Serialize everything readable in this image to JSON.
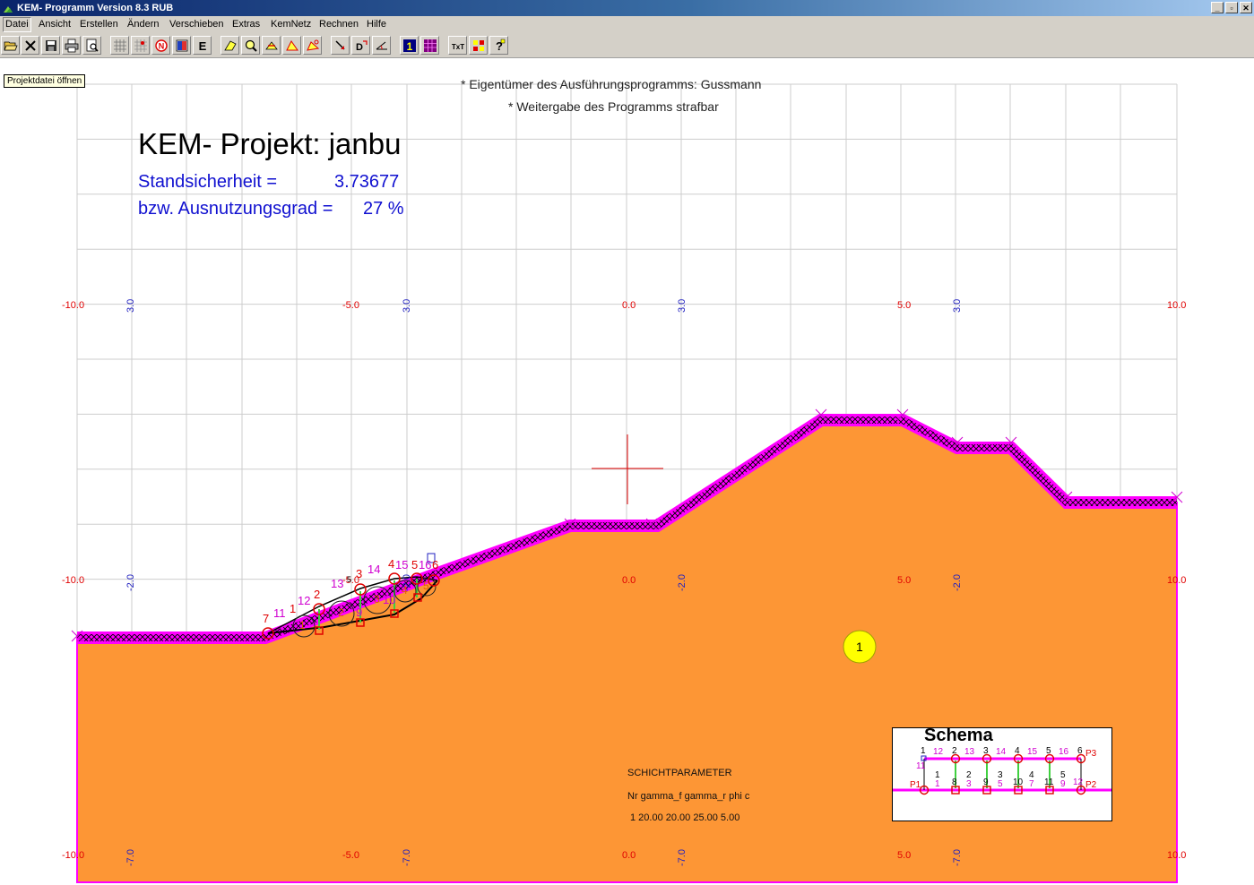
{
  "window": {
    "title": "KEM- Programm Version 8.3 RUB",
    "controls": [
      "_",
      "▫",
      "✕"
    ]
  },
  "menu": [
    "Datei",
    "Ansicht",
    "Erstellen",
    "Ändern",
    "Verschieben",
    "Extras",
    "KemNetz",
    "Rechnen",
    "Hilfe"
  ],
  "toolbar": {
    "buttons": [
      {
        "name": "open-icon",
        "tooltip": "Projektdatei öffnen"
      },
      {
        "name": "close-icon"
      },
      {
        "name": "save-icon"
      },
      {
        "name": "print-icon"
      },
      {
        "name": "print-preview-icon"
      },
      {
        "name": "grid-icon"
      },
      {
        "name": "grid-point-icon"
      },
      {
        "name": "north-icon"
      },
      {
        "name": "layer-icon"
      },
      {
        "name": "e-icon"
      },
      {
        "name": "edit-polygon-icon"
      },
      {
        "name": "zoom-icon"
      },
      {
        "name": "move-icon"
      },
      {
        "name": "triangle-icon"
      },
      {
        "name": "rotate-icon"
      },
      {
        "name": "arrow-down-icon"
      },
      {
        "name": "d-icon"
      },
      {
        "name": "angle-icon"
      },
      {
        "name": "one-icon"
      },
      {
        "name": "matrix-icon"
      },
      {
        "name": "text-icon"
      },
      {
        "name": "palette-icon"
      },
      {
        "name": "help-icon"
      }
    ]
  },
  "tooltip": "Projektdatei öffnen",
  "notices": [
    "* Eigentümer des Ausführungsprogramms: Gussmann",
    "* Weitergabe des Programms strafbar"
  ],
  "project": {
    "title": "KEM- Projekt: janbu",
    "safety_label": "Standsicherheit =",
    "safety_value": "3.73677",
    "utilization_label": "bzw. Ausnutzungsgrad =",
    "utilization_value": "27 %"
  },
  "axes": {
    "red_labels_top": [
      "-10.0",
      "-5.0",
      "0.0",
      "5.0",
      "10.0"
    ],
    "red_labels_mid": [
      "-10.0",
      "-5.0",
      "0.0",
      "5.0",
      "10.0"
    ],
    "red_labels_bottom": [
      "-10.0",
      "-5.0",
      "0.0",
      "5.0",
      "10.0"
    ],
    "blue_labels_top": [
      "3.0",
      "3.0",
      "3.0",
      "3.0"
    ],
    "blue_labels_mid": [
      "-2.0",
      "-2.0",
      "-2.0",
      "-2.0"
    ],
    "blue_labels_bottom": [
      "-7.0",
      "-7.0",
      "-7.0",
      "-7.0"
    ]
  },
  "layer": {
    "number": "1"
  },
  "schicht": {
    "heading": "SCHICHTPARAMETER",
    "columns": "Nr gamma_f gamma_r phi c",
    "row": "1  20.00  20.00  25.00     5.00"
  },
  "slope_labels": {
    "nodes_top": [
      "7",
      "11",
      "1",
      "12",
      "2",
      "13",
      "3",
      "14",
      "4",
      "15",
      "5",
      "16",
      "6"
    ],
    "nodes_bottom": [
      "8",
      "9",
      "10"
    ],
    "circle_numbers": [
      "1",
      "2",
      "3",
      "4",
      "5"
    ],
    "small": [
      "5",
      "6"
    ]
  },
  "schema": {
    "title": "Schema",
    "top_black": [
      "1",
      "2",
      "3",
      "4",
      "5",
      "6"
    ],
    "top_magenta": [
      "12",
      "13",
      "14",
      "15",
      "16"
    ],
    "mid_black": [
      "1",
      "2",
      "3",
      "4",
      "5"
    ],
    "bottom_magenta": [
      "1",
      "3",
      "5",
      "7",
      "9"
    ],
    "bottom_black": [
      "8",
      "9",
      "10",
      "11"
    ],
    "points": [
      "P1",
      "P2",
      "P3"
    ],
    "extra": [
      "11",
      "12"
    ]
  },
  "colors": {
    "soil": "#fd9635",
    "surface": "#ff00ff",
    "grid": "#c8c8c8",
    "axis_red": "#e00000",
    "axis_blue": "#2020c0",
    "layer_circle": "#ffff00"
  }
}
